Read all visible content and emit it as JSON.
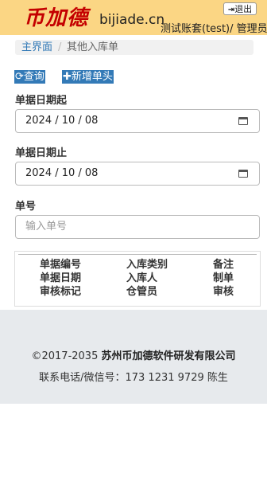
{
  "header": {
    "logo_text": "币加德",
    "domain": "bijiade.cn",
    "account": "测试账套(test)/ 管理员",
    "logout_label": "退出"
  },
  "breadcrumb": {
    "home": "主界面",
    "separator": "/",
    "current": "其他入库单"
  },
  "toolbar": {
    "query_label": "查询",
    "add_label": "新增单头"
  },
  "form": {
    "date_from_label": "单据日期起",
    "date_from_value": "2024 / 10 / 08",
    "date_to_label": "单据日期止",
    "date_to_value": "2024 / 10 / 08",
    "doc_no_label": "单号",
    "doc_no_placeholder": "输入单号"
  },
  "table": {
    "columns": [
      [
        "单据编号",
        "单据日期",
        "审核标记"
      ],
      [
        "入库类别",
        "入库人",
        "仓管员"
      ],
      [
        "备注",
        "制单",
        "审核"
      ]
    ]
  },
  "footer": {
    "copyright_prefix": "©2017-2035",
    "company": "苏州币加德软件研发有限公司",
    "contact": "联系电话/微信号：173 1231 9729 陈生"
  },
  "colors": {
    "header_bg": "#fbd684",
    "logo": "#c40000",
    "primary": "#337ab7",
    "footer_bg": "#e7eaed"
  }
}
